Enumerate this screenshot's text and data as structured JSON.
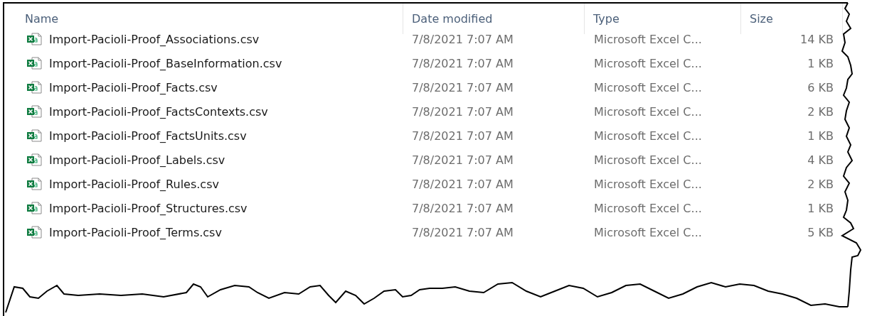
{
  "columns": [
    "Name",
    "Date modified",
    "Type",
    "Size"
  ],
  "rows": [
    {
      "name": "Import-Pacioli-Proof_Associations.csv",
      "date_modified": "7/8/2021 7:07 AM",
      "type": "Microsoft Excel C...",
      "size": "14 KB"
    },
    {
      "name": "Import-Pacioli-Proof_BaseInformation.csv",
      "date_modified": "7/8/2021 7:07 AM",
      "type": "Microsoft Excel C...",
      "size": "1 KB"
    },
    {
      "name": "Import-Pacioli-Proof_Facts.csv",
      "date_modified": "7/8/2021 7:07 AM",
      "type": "Microsoft Excel C...",
      "size": "6 KB"
    },
    {
      "name": "Import-Pacioli-Proof_FactsContexts.csv",
      "date_modified": "7/8/2021 7:07 AM",
      "type": "Microsoft Excel C...",
      "size": "2 KB"
    },
    {
      "name": "Import-Pacioli-Proof_FactsUnits.csv",
      "date_modified": "7/8/2021 7:07 AM",
      "type": "Microsoft Excel C...",
      "size": "1 KB"
    },
    {
      "name": "Import-Pacioli-Proof_Labels.csv",
      "date_modified": "7/8/2021 7:07 AM",
      "type": "Microsoft Excel C...",
      "size": "4 KB"
    },
    {
      "name": "Import-Pacioli-Proof_Rules.csv",
      "date_modified": "7/8/2021 7:07 AM",
      "type": "Microsoft Excel C...",
      "size": "2 KB"
    },
    {
      "name": "Import-Pacioli-Proof_Structures.csv",
      "date_modified": "7/8/2021 7:07 AM",
      "type": "Microsoft Excel C...",
      "size": "1 KB"
    },
    {
      "name": "Import-Pacioli-Proof_Terms.csv",
      "date_modified": "7/8/2021 7:07 AM",
      "type": "Microsoft Excel C...",
      "size": "5 KB"
    }
  ]
}
